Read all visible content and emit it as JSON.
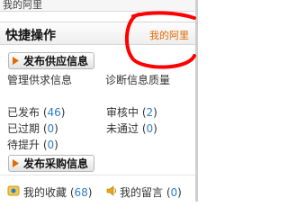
{
  "top": {
    "title": "我的阿里"
  },
  "panel": {
    "title": "快捷操作",
    "link": "我的阿里"
  },
  "actions": {
    "publish_supply": "发布供应信息",
    "publish_purchase": "发布采购信息"
  },
  "links": {
    "manage_supply": "管理供求信息",
    "diagnose_quality": "诊断信息质量"
  },
  "status": [
    {
      "label": "已发布",
      "count": "46"
    },
    {
      "label": "审核中",
      "count": "2"
    },
    {
      "label": "已过期",
      "count": "0"
    },
    {
      "label": "未通过",
      "count": "0"
    },
    {
      "label": "待提升",
      "count": "0"
    }
  ],
  "footer": {
    "favorites_label": "我的收藏",
    "favorites_count": "68",
    "messages_label": "我的留言",
    "messages_count": "0"
  },
  "colors": {
    "link_orange": "#e06a00",
    "count_blue": "#2a7dcb",
    "annotation_red": "#ff0000"
  },
  "icons": [
    "arrow-right-icon",
    "favorites-icon",
    "speaker-icon"
  ]
}
